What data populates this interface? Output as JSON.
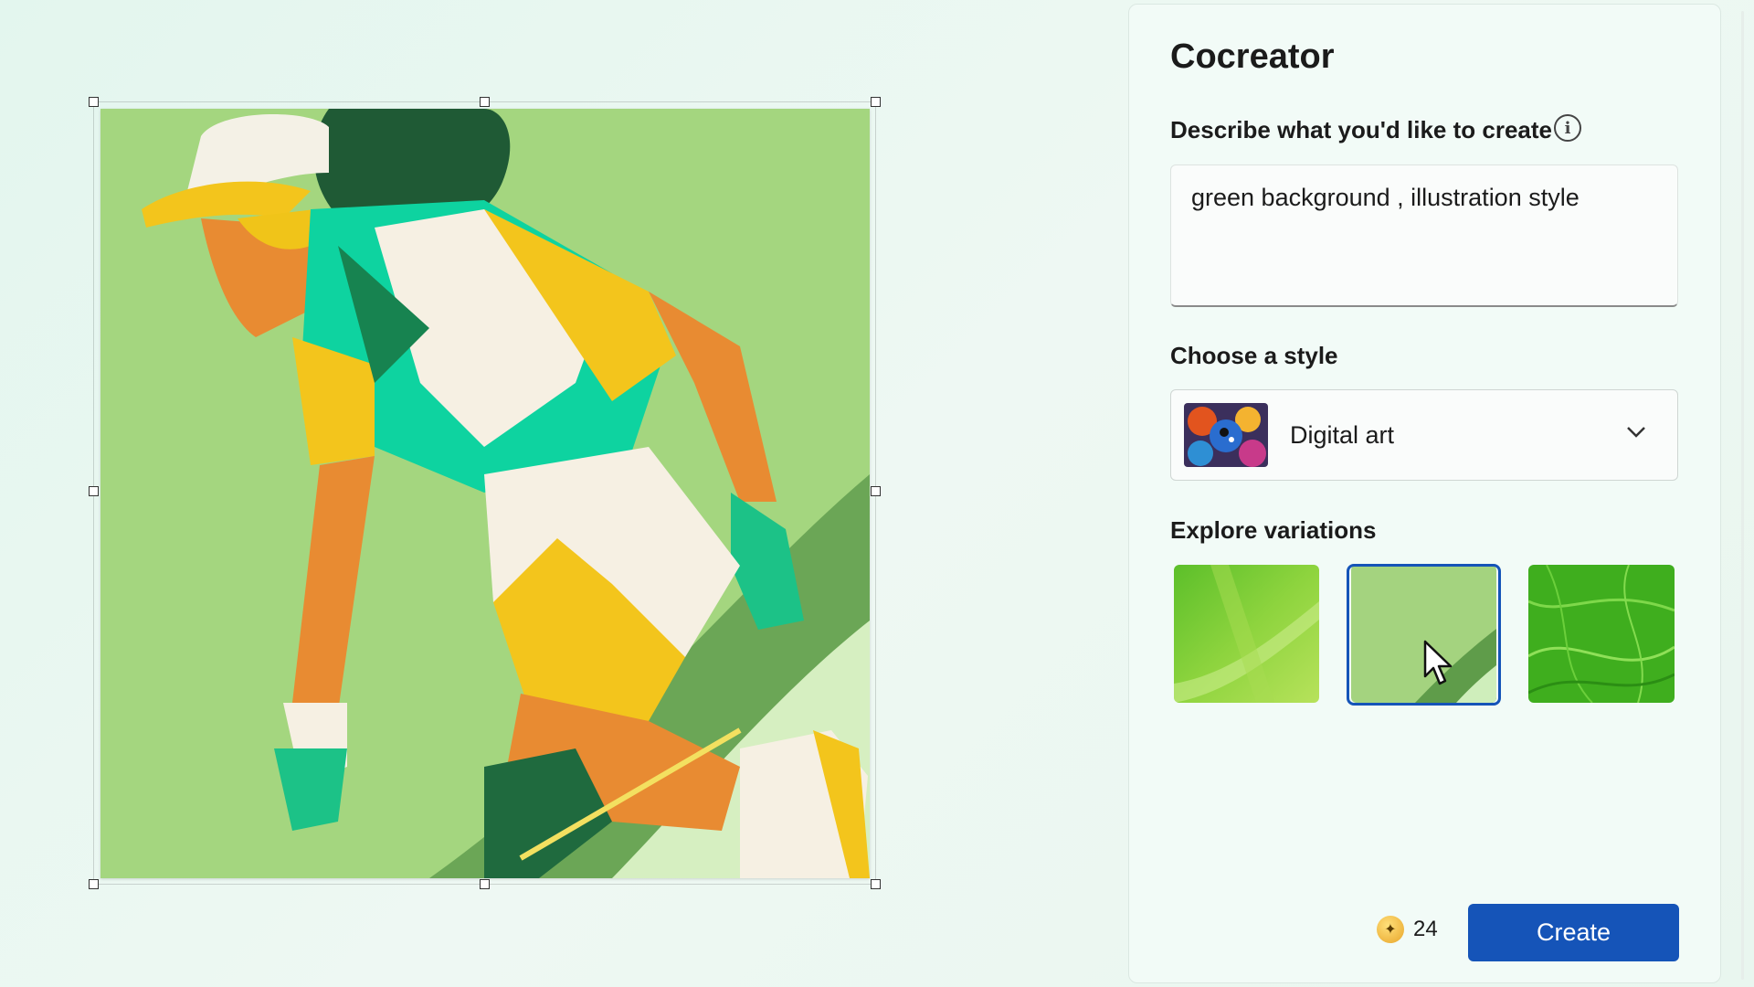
{
  "panel": {
    "title": "Cocreator",
    "describe_label": "Describe what you'd like to create",
    "info_icon": "info-icon",
    "prompt_value": "green background , illustration style",
    "style_label": "Choose a style",
    "style_selected": "Digital art",
    "variations_label": "Explore variations",
    "variations": [
      {
        "name": "variation-1",
        "selected": false
      },
      {
        "name": "variation-2",
        "selected": true
      },
      {
        "name": "variation-3",
        "selected": false
      }
    ],
    "credits": "24",
    "create_button": "Create"
  },
  "colors": {
    "accent": "#1554b8",
    "canvas_bg": "#a4d67f",
    "panel_bg": "#f2fbf7"
  }
}
